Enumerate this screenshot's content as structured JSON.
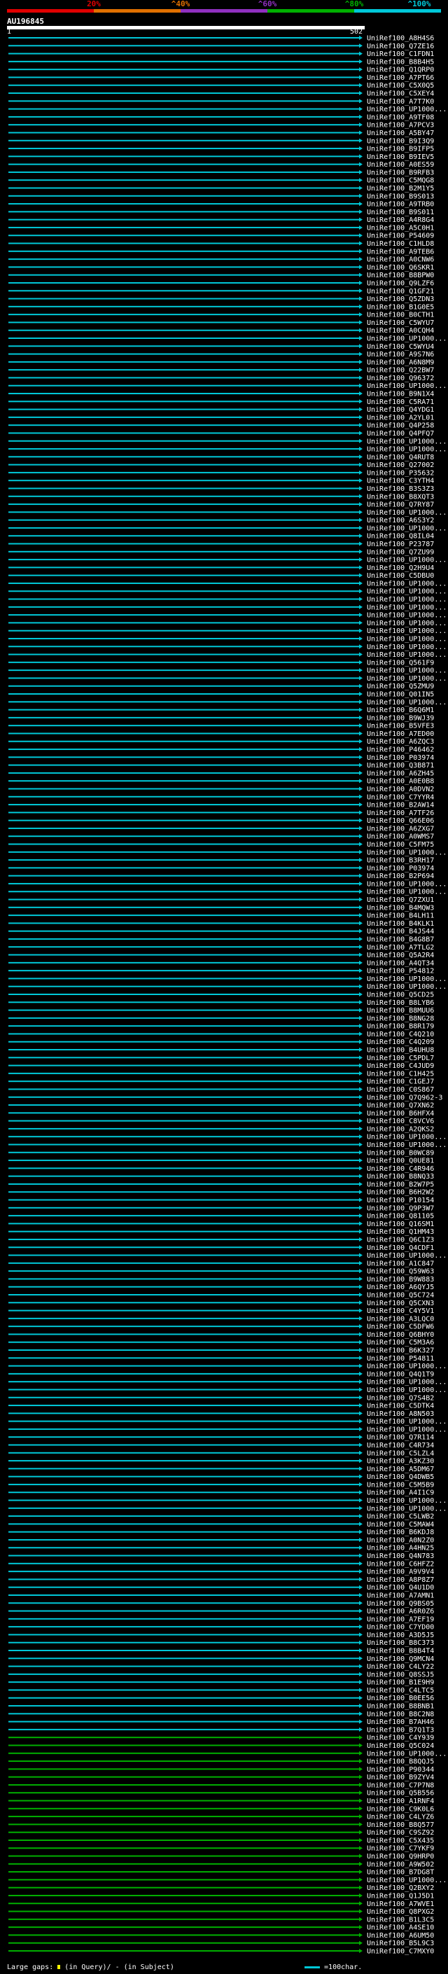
{
  "legend": {
    "ticks": [
      "20%",
      "^40%",
      "^60%",
      "^80%",
      "^100%"
    ],
    "band_colors": [
      "#e00000",
      "#e07000",
      "#9030c0",
      "#00b000",
      "#00c8d8"
    ]
  },
  "query": {
    "name": "AU196845",
    "start": "1",
    "end": "502"
  },
  "footer": {
    "left_label": "Large gaps:",
    "in_query": "(in Query)/",
    "in_subject": "- (in Subject)",
    "scale": "=100char."
  },
  "hit_colors": {
    "cyan": "#00c8d8",
    "green": "#00b000",
    "magenta": "#c000a0"
  },
  "hits": [
    "UniRef100_A8H4S6",
    "UniRef100_Q7ZE16",
    "UniRef100_C1FDN1",
    "UniRef100_B8B4H5",
    "UniRef100_Q1QRP0",
    "UniRef100_A7PT66",
    "UniRef100_C5X0Q5",
    "UniRef100_C5XEY4",
    "UniRef100_A7T7K0",
    "UniRef100_UP1000...",
    "UniRef100_A9TF08",
    "UniRef100_A7PCV3",
    "UniRef100_A5BY47",
    "UniRef100_B9I3Q9",
    "UniRef100_B9IFP5",
    "UniRef100_B9IEV5",
    "UniRef100_A0ES59",
    "UniRef100_B9RFB3",
    "UniRef100_C5MQG8",
    "UniRef100_B2M1Y5",
    "UniRef100_B9S013",
    "UniRef100_A9TRB0",
    "UniRef100_B9S011",
    "UniRef100_A4R8G4",
    "UniRef100_A5C0H1",
    "UniRef100_P54609",
    "UniRef100_C1HLD8",
    "UniRef100_A9TEB6",
    "UniRef100_A0CNW6",
    "UniRef100_Q6SKR1",
    "UniRef100_B8BPW0",
    "UniRef100_Q9LZF6",
    "UniRef100_Q1GF21",
    "UniRef100_Q5ZDN3",
    "UniRef100_B1G0E5",
    "UniRef100_B0CTH1",
    "UniRef100_C5WYU7",
    "UniRef100_A0CQH4",
    "UniRef100_UP1000...",
    "UniRef100_C5WYU4",
    "UniRef100_A9S7N6",
    "UniRef100_A6N8M9",
    "UniRef100_Q22BW7",
    "UniRef100_Q96372",
    "UniRef100_UP1000...",
    "UniRef100_B9N1X4",
    "UniRef100_C5RA71",
    "UniRef100_Q4YDG1",
    "UniRef100_A2YL01",
    "UniRef100_Q4P258",
    "UniRef100_Q4PFQ7",
    "UniRef100_UP1000...",
    "UniRef100_UP1000...",
    "UniRef100_Q4RUT8",
    "UniRef100_Q27002",
    "UniRef100_P35632",
    "UniRef100_C3YTH4",
    "UniRef100_B3S3Z3",
    "UniRef100_B8XQT3",
    "UniRef100_Q7RY87",
    "UniRef100_UP1000...",
    "UniRef100_A6S3Y2",
    "UniRef100_UP1000...",
    "UniRef100_Q8IL04",
    "UniRef100_P23787",
    "UniRef100_Q7ZU99",
    "UniRef100_UP1000...",
    "UniRef100_Q2H9U4",
    "UniRef100_C5DBU0",
    "UniRef100_UP1000...",
    "UniRef100_UP1000...",
    "UniRef100_UP1000...",
    "UniRef100_UP1000...",
    "UniRef100_UP1000...",
    "UniRef100_UP1000...",
    "UniRef100_UP1000...",
    "UniRef100_UP1000...",
    "UniRef100_UP1000...",
    "UniRef100_UP1000...",
    "UniRef100_Q561F9",
    "UniRef100_UP1000...",
    "UniRef100_UP1000...",
    "UniRef100_Q5ZMU9",
    "UniRef100_Q01IN5",
    "UniRef100_UP1000...",
    "UniRef100_B6Q6M1",
    "UniRef100_B9WJ39",
    "UniRef100_B5VFE3",
    "UniRef100_A7ED00",
    "UniRef100_A6ZQC3",
    "UniRef100_P46462",
    "UniRef100_P03974",
    "UniRef100_Q3B871",
    "UniRef100_A6ZH45",
    "UniRef100_A0E0B8",
    "UniRef100_A0DVN2",
    "UniRef100_C7YYR4",
    "UniRef100_B2AW14",
    "UniRef100_A7TF26",
    "UniRef100_Q66E06",
    "UniRef100_A6ZXG7",
    "UniRef100_A0WMS7",
    "UniRef100_C5FM75",
    "UniRef100_UP1000...",
    "UniRef100_B3RH17",
    "UniRef100_P03974",
    "UniRef100_B2P694",
    "UniRef100_UP1000...",
    "UniRef100_UP1000...",
    "UniRef100_Q7ZXU1",
    "UniRef100_B4MQW3",
    "UniRef100_B4LH11",
    "UniRef100_B4KLK1",
    "UniRef100_B4JS44",
    "UniRef100_B4G8B7",
    "UniRef100_A7TLG2",
    "UniRef100_Q5A2R4",
    "UniRef100_A4QT34",
    "UniRef100_P54812",
    "UniRef100_UP1000...",
    "UniRef100_UP1000...",
    "UniRef100_Q5CD25",
    "UniRef100_B8LYB6",
    "UniRef100_B8MUU6",
    "UniRef100_B8NG28",
    "UniRef100_B8R179",
    "UniRef100_C4Q210",
    "UniRef100_C4Q209",
    "UniRef100_B4UHU8",
    "UniRef100_C5PDL7",
    "UniRef100_C4JUD9",
    "UniRef100_C1H425",
    "UniRef100_C1GEJ7",
    "UniRef100_C0S867",
    "UniRef100_Q7Q962-3",
    "UniRef100_Q7XN62",
    "UniRef100_B6HFX4",
    "UniRef100_C8VCV6",
    "UniRef100_A2QKS2",
    "UniRef100_UP1000...",
    "UniRef100_UP1000...",
    "UniRef100_B0WC89",
    "UniRef100_Q0UE81",
    "UniRef100_C4R946",
    "UniRef100_B8NQ33",
    "UniRef100_B2W7P5",
    "UniRef100_B6H2W2",
    "UniRef100_P10154",
    "UniRef100_Q9P3W7",
    "UniRef100_Q81105",
    "UniRef100_Q16SM1",
    "UniRef100_Q1HM43",
    "UniRef100_Q6C1Z3",
    "UniRef100_Q4CDF1",
    "UniRef100_UP1000...",
    "UniRef100_A1C847",
    "UniRef100_Q59W63",
    "UniRef100_B9W883",
    "UniRef100_A6QYJ5",
    "UniRef100_Q5C724",
    "UniRef100_Q5CXN3",
    "UniRef100_C4Y5V1",
    "UniRef100_A3LQC0",
    "UniRef100_C5DFW6",
    "UniRef100_Q6BHY0",
    "UniRef100_C5M3A6",
    "UniRef100_B6K327",
    "UniRef100_P54811",
    "UniRef100_UP1000...",
    "UniRef100_Q4Q1T9",
    "UniRef100_UP1000...",
    "UniRef100_UP1000...",
    "UniRef100_Q7S4B2",
    "UniRef100_C5DTK4",
    "UniRef100_A8N503",
    "UniRef100_UP1000...",
    "UniRef100_UP1000...",
    "UniRef100_Q7R114",
    "UniRef100_C4R734",
    "UniRef100_C5LZL4",
    "UniRef100_A3KZ30",
    "UniRef100_A5DM67",
    "UniRef100_Q4DWB5",
    "UniRef100_C5M5B9",
    "UniRef100_A4I1C9",
    "UniRef100_UP1000...",
    "UniRef100_UP1000...",
    "UniRef100_C5LWB2",
    "UniRef100_C5MAW4",
    "UniRef100_B6KDJ8",
    "UniRef100_A0N2Z0",
    "UniRef100_A4HN25",
    "UniRef100_Q4N783",
    "UniRef100_C6HFZ2",
    "UniRef100_A9V9V4",
    "UniRef100_A8P8Z7",
    "UniRef100_Q4U1D0",
    "UniRef100_A7AMN1",
    "UniRef100_Q9BS05",
    "UniRef100_A6R0Z6",
    "UniRef100_A7EF19",
    "UniRef100_C7YD00",
    "UniRef100_A3D5J5",
    "UniRef100_B8C373",
    "UniRef100_B8B4T4",
    "UniRef100_Q9MCN4",
    "UniRef100_C4LY22",
    "UniRef100_Q8SSJ5",
    "UniRef100_B1E9H9",
    "UniRef100_C4LTC5",
    "UniRef100_B0EE56",
    "UniRef100_B8BNB1",
    "UniRef100_B8C2N8",
    "UniRef100_B7AH46",
    "UniRef100_B7Q1T3",
    "UniRef100_C4Y939",
    "UniRef100_Q5C024",
    "UniRef100_UP1000...",
    "UniRef100_B8QQJ5",
    "UniRef100_P90344",
    "UniRef100_B9ZYV4",
    "UniRef100_C7P7N8",
    "UniRef100_Q5B556",
    "UniRef100_A1RNF4",
    "UniRef100_C9K0L6",
    "UniRef100_C4LYZ6",
    "UniRef100_B8Q577",
    "UniRef100_C9SZ92",
    "UniRef100_C5X435",
    "UniRef100_C7YKF9",
    "UniRef100_Q9HRP0",
    "UniRef100_A9W502",
    "UniRef100_B7DG8T",
    "UniRef100_UP1000...",
    "UniRef100_Q2BXY2",
    "UniRef100_Q1J5D1",
    "UniRef100_A7WVE1",
    "UniRef100_Q8PXG2",
    "UniRef100_B1L3C5",
    "UniRef100_A4SE10",
    "UniRef100_A6UM50",
    "UniRef100_B5L9C3",
    "UniRef100_C7MXY0"
  ]
}
